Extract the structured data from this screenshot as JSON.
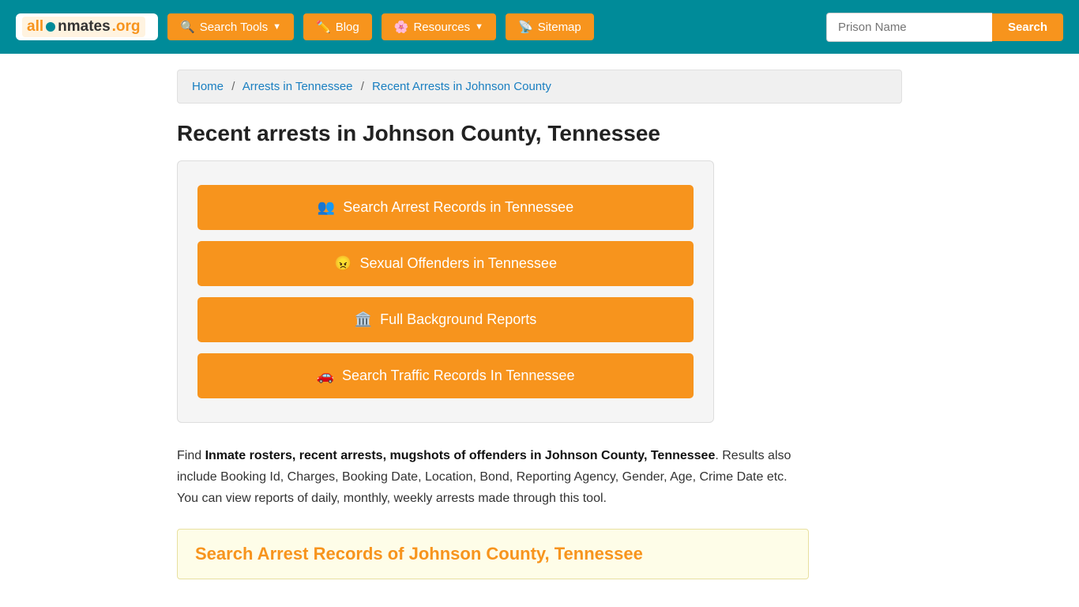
{
  "header": {
    "logo_text": "all Inmates .org",
    "nav": [
      {
        "id": "search-tools",
        "label": "Search Tools",
        "has_dropdown": true,
        "icon": "🔍"
      },
      {
        "id": "blog",
        "label": "Blog",
        "has_dropdown": false,
        "icon": "✏️"
      },
      {
        "id": "resources",
        "label": "Resources",
        "has_dropdown": true,
        "icon": "🌸"
      },
      {
        "id": "sitemap",
        "label": "Sitemap",
        "has_dropdown": false,
        "icon": "📡"
      }
    ],
    "search_placeholder": "Prison Name",
    "search_button_label": "Search"
  },
  "breadcrumb": {
    "items": [
      {
        "label": "Home",
        "href": "#"
      },
      {
        "label": "Arrests in Tennessee",
        "href": "#"
      },
      {
        "label": "Recent Arrests in Johnson County",
        "href": "#"
      }
    ]
  },
  "page_title": "Recent arrests in Johnson County, Tennessee",
  "action_buttons": [
    {
      "id": "arrest-records",
      "label": "Search Arrest Records in Tennessee",
      "icon": "👥"
    },
    {
      "id": "sexual-offenders",
      "label": "Sexual Offenders in Tennessee",
      "icon": "😠"
    },
    {
      "id": "background-reports",
      "label": "Full Background Reports",
      "icon": "🏛️"
    },
    {
      "id": "traffic-records",
      "label": "Search Traffic Records In Tennessee",
      "icon": "🚗"
    }
  ],
  "description": {
    "intro": "Find ",
    "bold_text": "Inmate rosters, recent arrests, mugshots of offenders in Johnson County, Tennessee",
    "rest": ". Results also include Booking Id, Charges, Booking Date, Location, Bond, Reporting Agency, Gender, Age, Crime Date etc. You can view reports of daily, monthly, weekly arrests made through this tool."
  },
  "section_search": {
    "title": "Search Arrest Records of Johnson County, Tennessee"
  }
}
